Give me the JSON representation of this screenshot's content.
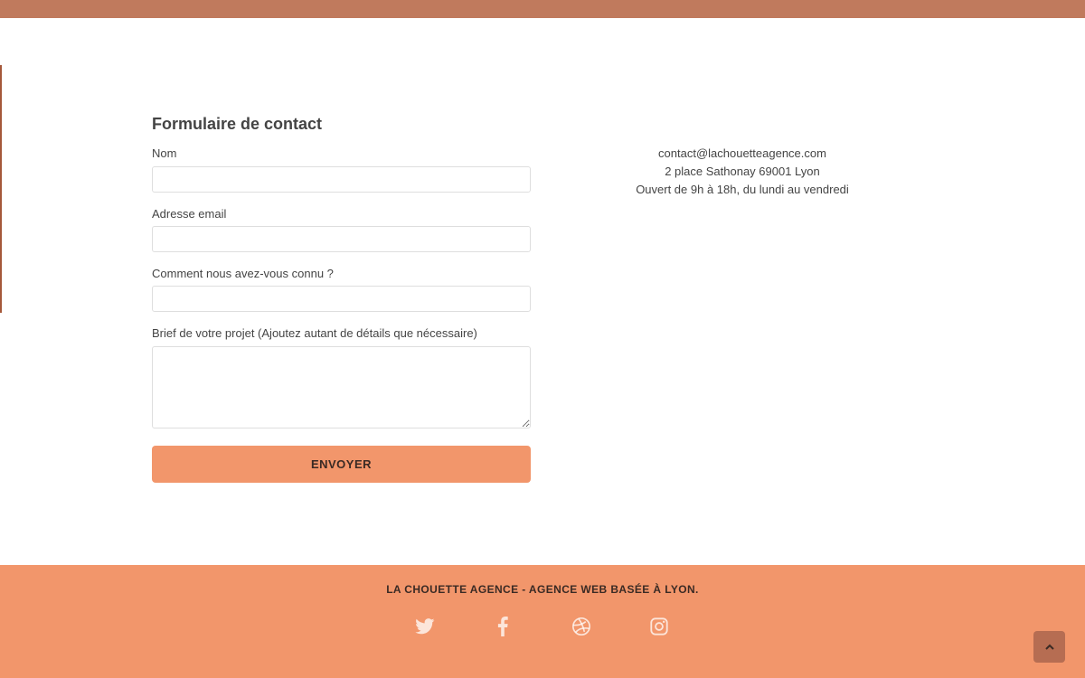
{
  "form": {
    "title": "Formulaire de contact",
    "fields": [
      {
        "label": "Nom",
        "value": ""
      },
      {
        "label": "Adresse email",
        "value": ""
      },
      {
        "label": "Comment nous avez-vous connu ?",
        "value": ""
      },
      {
        "label": "Brief de votre projet (Ajoutez autant de détails que nécessaire)",
        "value": ""
      }
    ],
    "submit_label": "ENVOYER"
  },
  "contact": {
    "email": "contact@lachouetteagence.com",
    "address": "2 place Sathonay 69001 Lyon",
    "hours": "Ouvert de 9h à 18h, du lundi au vendredi"
  },
  "footer": {
    "title": "LA CHOUETTE AGENCE - AGENCE WEB BASÉE À LYON.",
    "social_icons": [
      "twitter-icon",
      "facebook-icon",
      "dribbble-icon",
      "instagram-icon"
    ]
  },
  "scroll_top_icon": "chevron-up-icon",
  "colors": {
    "accent": "#f2966b",
    "top_band": "#c07a5d",
    "scroll_button": "#b66d52",
    "footer_text": "#3a2a24"
  }
}
